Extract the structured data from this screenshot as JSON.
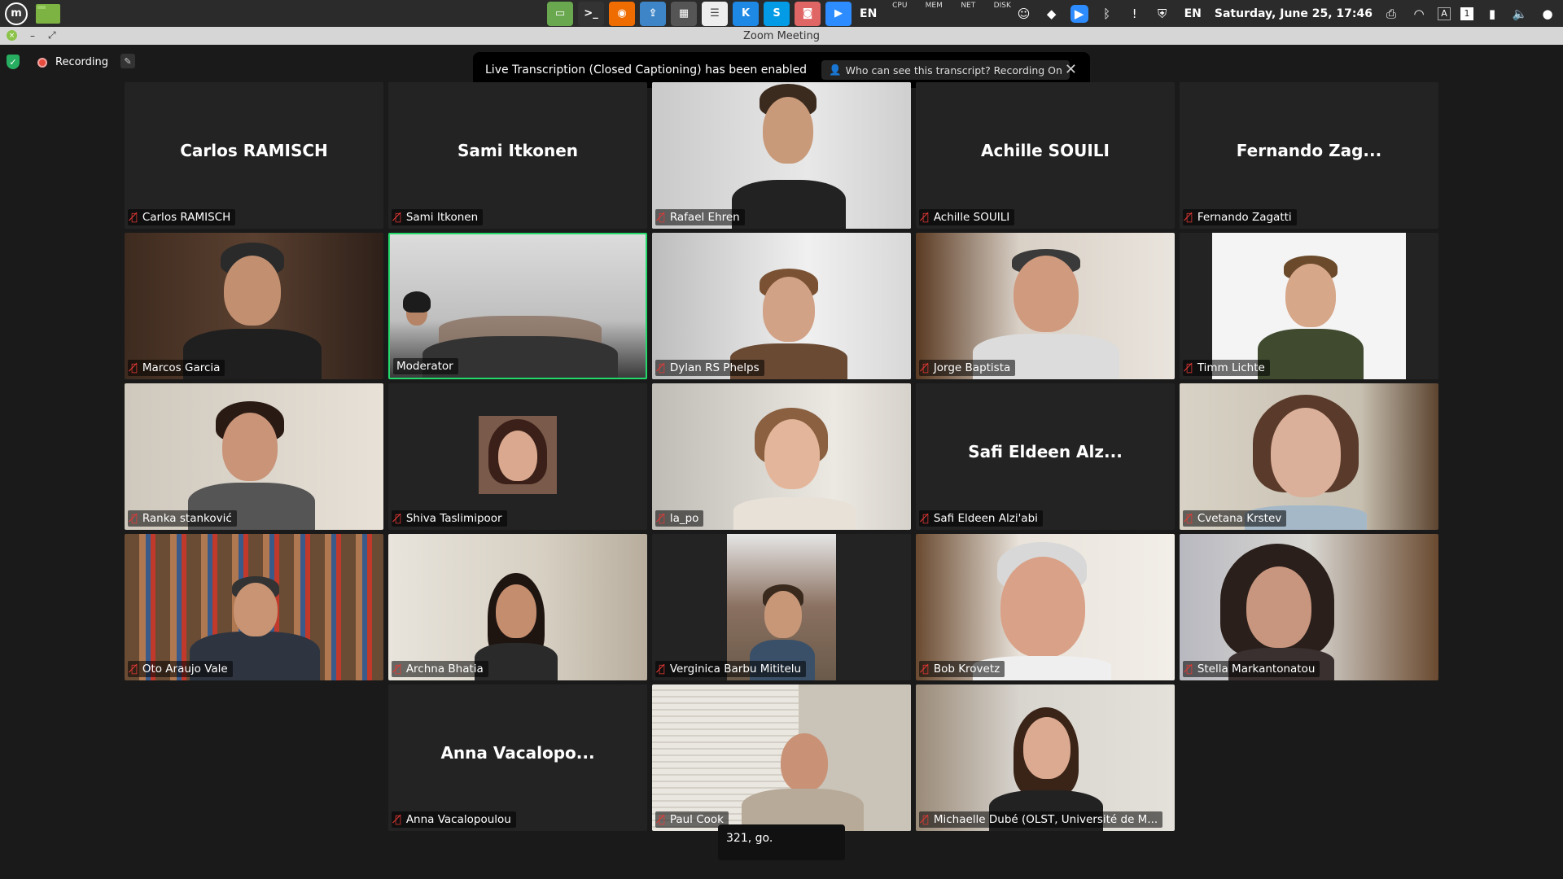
{
  "system_panel": {
    "keyboard_layout_1": "EN",
    "monitors": [
      "CPU",
      "MEM",
      "NET",
      "DISK"
    ],
    "keyboard_layout_2": "EN",
    "clock": "Saturday, June 25, 17:46",
    "workspace_number": "1"
  },
  "window": {
    "title": "Zoom Meeting"
  },
  "zoom_bar": {
    "recording_label": "Recording"
  },
  "banner": {
    "message": "Live Transcription (Closed Captioning) has been enabled",
    "transcript_button": "Who can see this transcript? Recording On"
  },
  "participants": [
    {
      "label": "Carlos RAMISCH",
      "display_name": "Carlos RAMISCH",
      "video": false,
      "muted": true
    },
    {
      "label": "Sami Itkonen",
      "display_name": "Sami Itkonen",
      "video": false,
      "muted": true
    },
    {
      "label": "Rafael Ehren",
      "video": true,
      "muted": true
    },
    {
      "label": "Achille SOUILI",
      "display_name": "Achille SOUILI",
      "video": false,
      "muted": true
    },
    {
      "label": "Fernando Zagatti",
      "display_name": "Fernando Zag...",
      "video": false,
      "muted": true
    },
    {
      "label": "Marcos Garcia",
      "video": true,
      "muted": true
    },
    {
      "label": "Moderator",
      "video": true,
      "muted": false,
      "active_speaker": true
    },
    {
      "label": "Dylan RS Phelps",
      "video": true,
      "muted": true
    },
    {
      "label": "Jorge Baptista",
      "video": true,
      "muted": true
    },
    {
      "label": "Timm Lichte",
      "video": true,
      "muted": true
    },
    {
      "label": "Ranka stanković",
      "video": true,
      "muted": true
    },
    {
      "label": "Shiva Taslimipoor",
      "video": false,
      "avatar": true,
      "muted": true
    },
    {
      "label": "la_po",
      "video": true,
      "muted": true
    },
    {
      "label": "Safi Eldeen Alzi'abi",
      "display_name": "Safi Eldeen Alz...",
      "video": false,
      "muted": true
    },
    {
      "label": "Cvetana Krstev",
      "video": true,
      "muted": true
    },
    {
      "label": "Oto Araujo Vale",
      "video": true,
      "muted": true
    },
    {
      "label": "Archna Bhatia",
      "video": true,
      "muted": true
    },
    {
      "label": "Verginica Barbu Mititelu",
      "video": true,
      "muted": true
    },
    {
      "label": "Bob Krovetz",
      "video": true,
      "muted": true
    },
    {
      "label": "Stella Markantonatou",
      "video": true,
      "muted": true
    },
    {
      "label": "Anna Vacalopoulou",
      "display_name": "Anna Vacalopo...",
      "video": false,
      "muted": true
    },
    {
      "label": "Paul Cook",
      "video": true,
      "muted": true
    },
    {
      "label": "Michaelle Dubé (OLST, Université de M...",
      "video": true,
      "muted": true
    }
  ],
  "caption": {
    "text": "321, go."
  },
  "colors": {
    "active_speaker_border": "#23d96a",
    "recording_dot": "#e74c3c",
    "muted_mic": "#e53935",
    "security_shield": "#27ae60"
  },
  "icons": {
    "tray": [
      "files-icon",
      "terminal-icon",
      "firefox-icon",
      "upload-icon",
      "calculator-icon",
      "settings-icon",
      "k-app-icon",
      "skype-icon",
      "mic-app-icon",
      "zoom-icon"
    ],
    "system_right": [
      "discord-icon",
      "dropbox-icon",
      "zoom-tray-icon",
      "bluetooth-icon",
      "clipboard-icon",
      "shield-update-icon",
      "printer-icon",
      "wifi-icon",
      "keyboard-icon",
      "battery-icon",
      "volume-muted-icon",
      "user-icon"
    ]
  }
}
